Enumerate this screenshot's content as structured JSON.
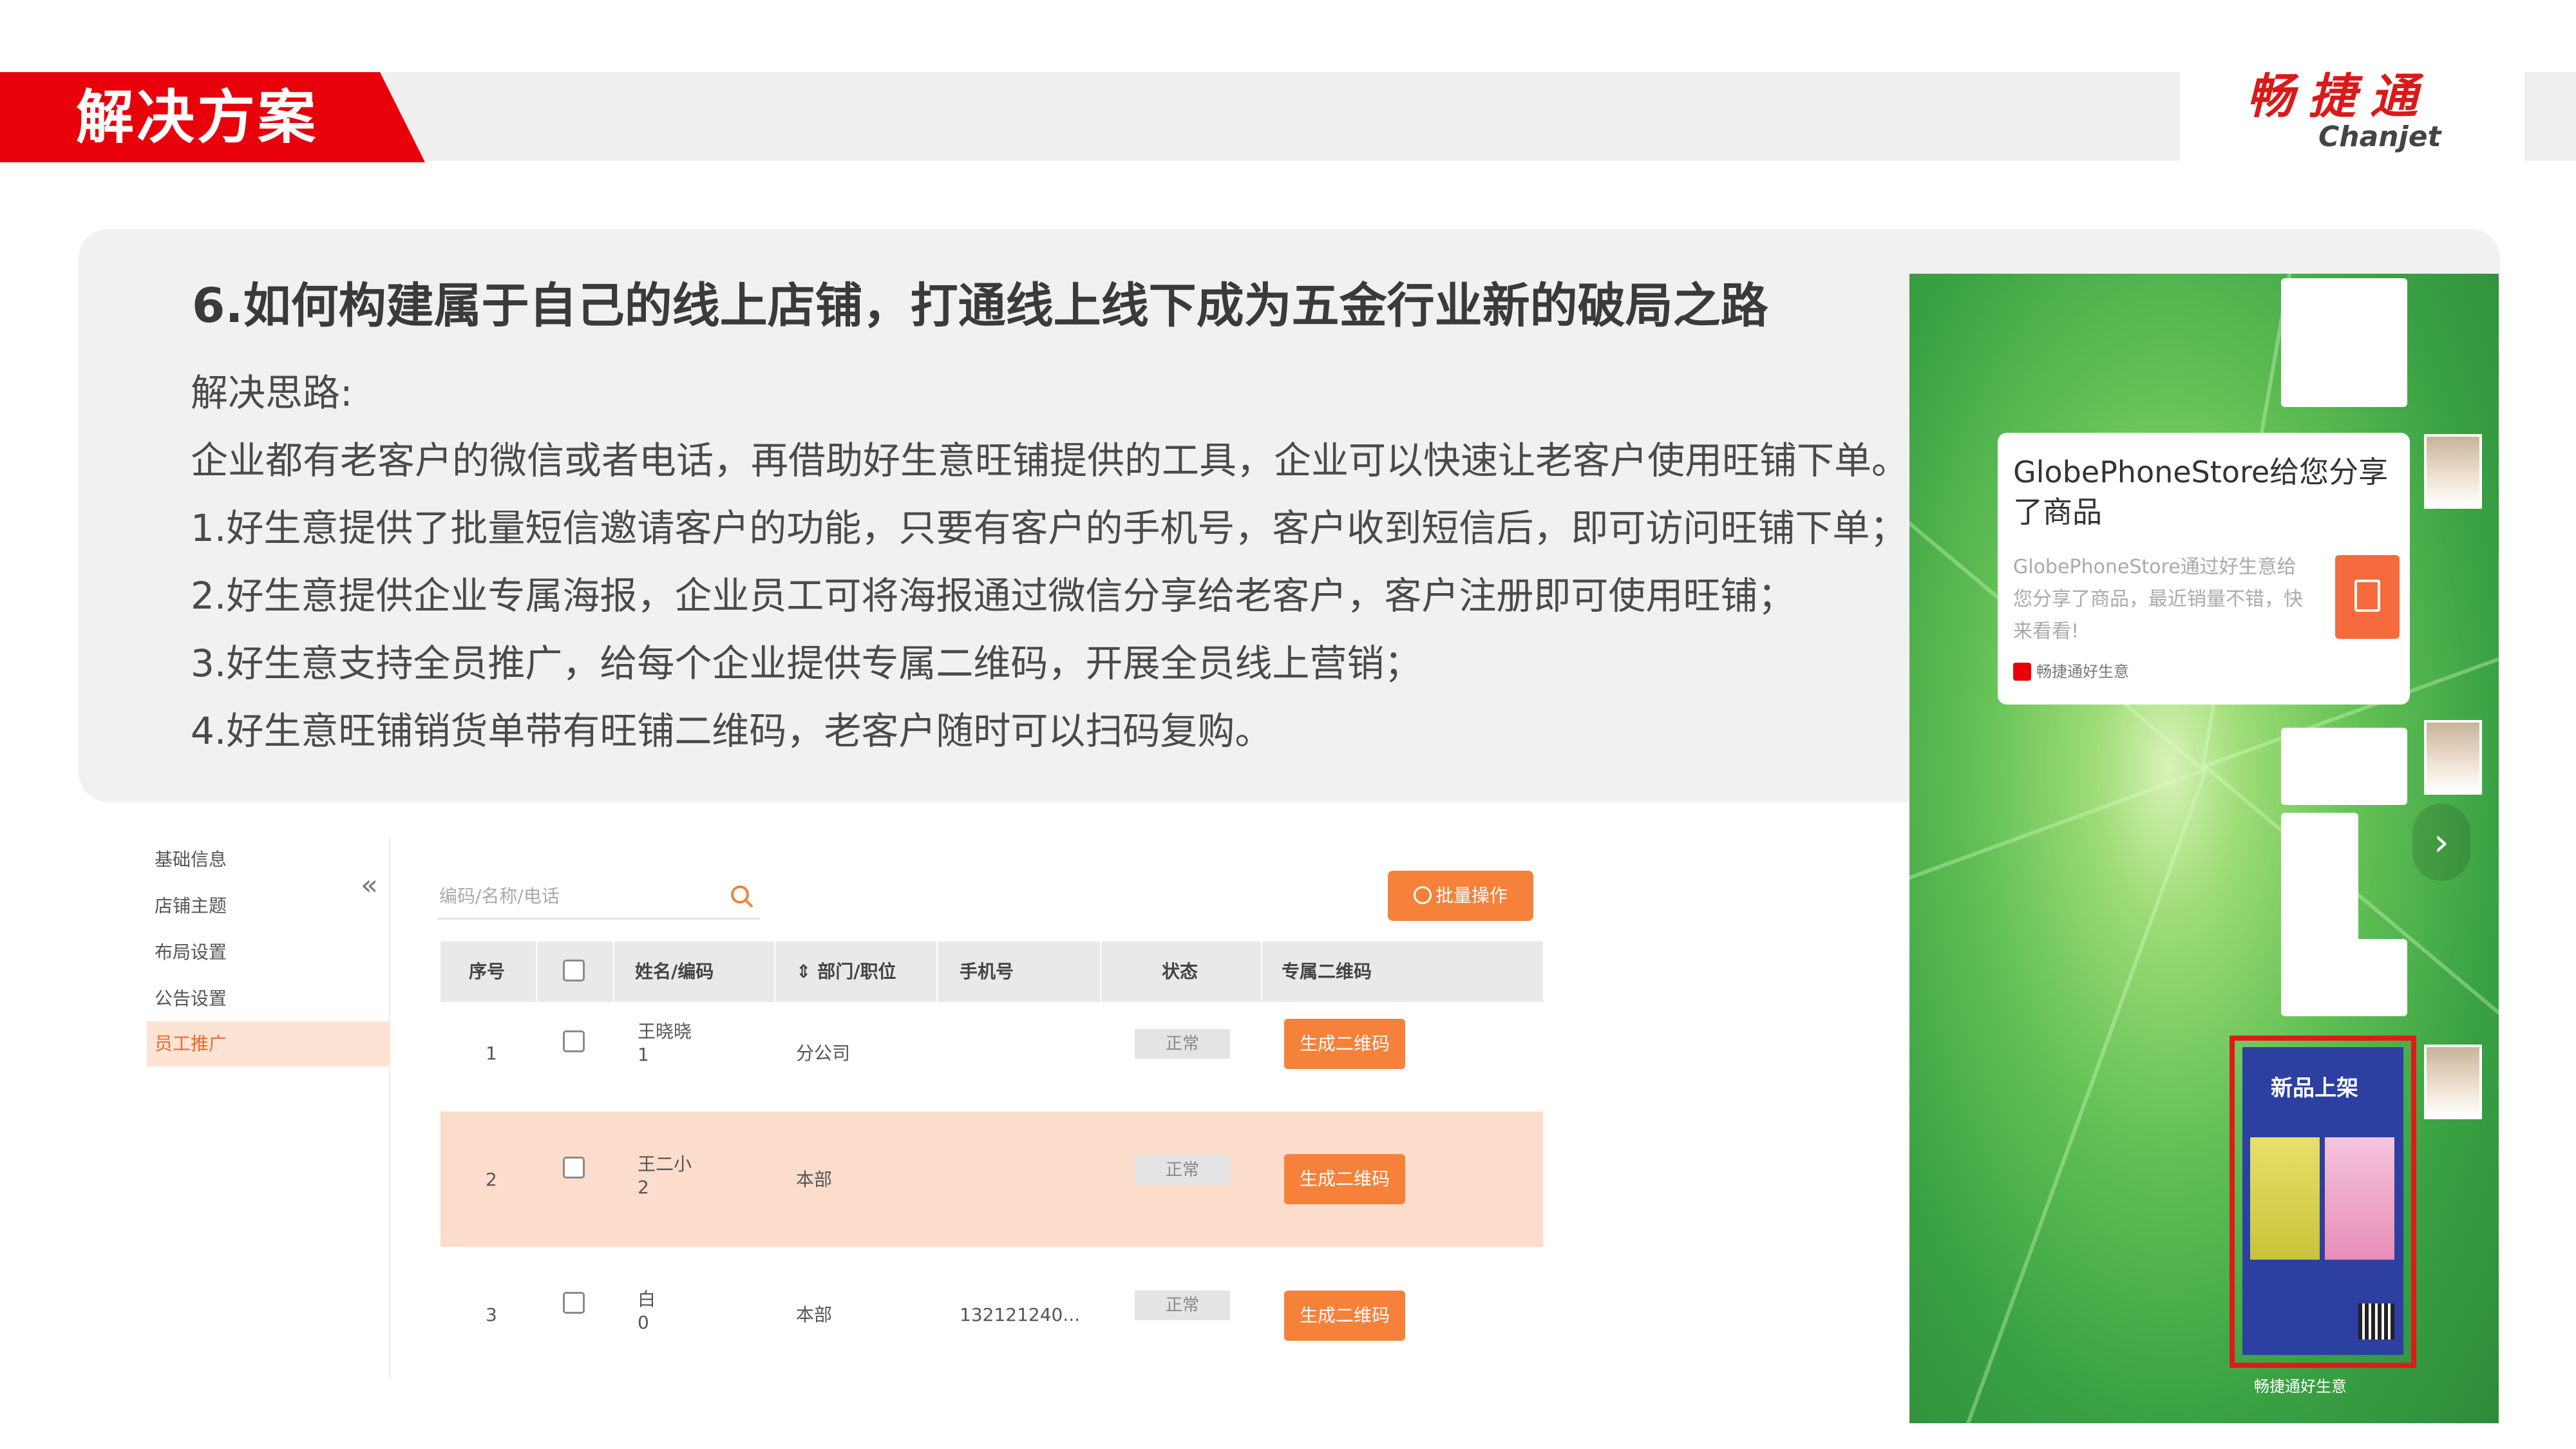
{
  "header": {
    "title": "解决方案",
    "logo_cn": "畅捷通",
    "logo_en": "Chanjet"
  },
  "panel": {
    "heading": "6.如何构建属于自己的线上店铺，打通线上线下成为五金行业新的破局之路",
    "lines": [
      "解决思路:",
      "企业都有老客户的微信或者电话，再借助好生意旺铺提供的工具，企业可以快速让老客户使用旺铺下单。",
      "1.好生意提供了批量短信邀请客户的功能，只要有客户的手机号，客户收到短信后，即可访问旺铺下单；",
      "2.好生意提供企业专属海报，企业员工可将海报通过微信分享给老客户，客户注册即可使用旺铺；",
      "3.好生意支持全员推广，给每个企业提供专属二维码，开展全员线上营销；",
      "4.好生意旺铺销货单带有旺铺二维码，老客户随时可以扫码复购。"
    ]
  },
  "admin": {
    "sidebar": [
      "基础信息",
      "店铺主题",
      "布局设置",
      "公告设置",
      "员工推广"
    ],
    "active_index": 4,
    "collapse_glyph": "«",
    "search_placeholder": "编码/名称/电话",
    "bulk_button": "批量操作",
    "columns": [
      "序号",
      "姓名/编码",
      "部门/职位",
      "手机号",
      "状态",
      "专属二维码"
    ],
    "rows": [
      {
        "index": "1",
        "name": "王晓晓",
        "code": "1",
        "dept": "分公司",
        "phone": "",
        "status": "正常",
        "action": "生成二维码"
      },
      {
        "index": "2",
        "name": "王二小",
        "code": "2",
        "dept": "本部",
        "phone": "",
        "status": "正常",
        "action": "生成二维码"
      },
      {
        "index": "3",
        "name": "白",
        "code": "0",
        "dept": "本部",
        "phone": "132121240...",
        "status": "正常",
        "action": "生成二维码"
      }
    ]
  },
  "phone": {
    "share_title": "GlobePhoneStore给您分享了商品",
    "share_sub": "GlobePhoneStore通过好生意给您分享了商品，最近销量不错，快来看看!",
    "share_foot": "畅捷通好生意",
    "poster_title": "新品上架",
    "poster_bottom": "畅捷通好生意",
    "next_glyph": "›"
  },
  "colors": {
    "brand_red": "#e8000b",
    "accent_orange": "#f5813b",
    "row_highlight": "#fcddcb"
  }
}
